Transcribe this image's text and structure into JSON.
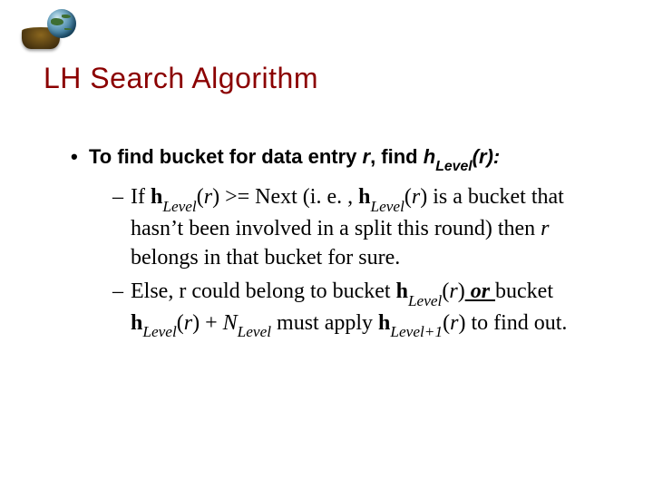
{
  "logo_alt": "database cylinder with globe",
  "title": "LH Search Algorithm",
  "bullets": {
    "level1": {
      "prefix": "To find bucket for data entry ",
      "var_r": "r",
      "mid": ", find ",
      "hfunc_h": "h",
      "hfunc_sub": "Level",
      "hfunc_open": "(",
      "hfunc_r": "r",
      "hfunc_close": ")",
      "suffix": ":"
    },
    "case_if": {
      "w1": "If ",
      "h1_h": "h",
      "h1_sub": "Level",
      "h1_open": "(",
      "h1_r": "r",
      "h1_close": ")",
      "w2": " >= Next (i. e. , ",
      "h2_h": "h",
      "h2_sub": "Level",
      "h2_open": "(",
      "h2_r": "r",
      "h2_close": ")",
      "w3": " is a bucket that hasn’t been involved in a split this round) then ",
      "r_var": "r",
      "w4": "  belongs in that bucket for sure."
    },
    "case_else": {
      "w1": "Else, r could belong to bucket ",
      "h1_h": "h",
      "h1_sub": "Level",
      "h1_open": "(",
      "h1_r": "r",
      "h1_close": ")",
      "w_or": " or ",
      "w2": "bucket ",
      "h2_h": "h",
      "h2_sub": "Level",
      "h2_open": "(",
      "h2_r": "r",
      "h2_close": ")",
      "w3": " + ",
      "N": "N",
      "N_sub": "Level",
      "w4": " must apply ",
      "h3_h": "h",
      "h3_sub": "Level+1",
      "h3_open": "(",
      "h3_r": "r",
      "h3_close": ")",
      "w5": " to find out."
    }
  }
}
